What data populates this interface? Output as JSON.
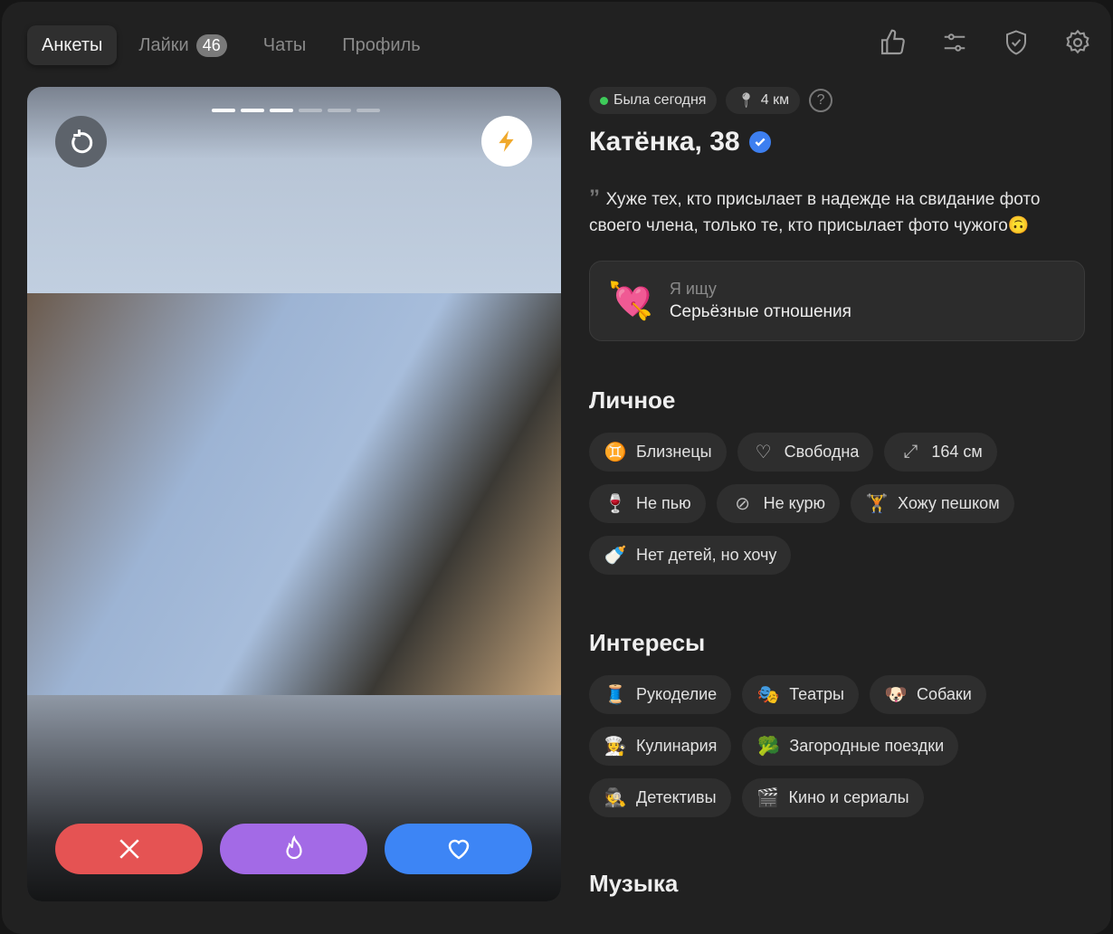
{
  "nav": {
    "tabs": [
      {
        "label": "Анкеты"
      },
      {
        "label": "Лайки",
        "badge": "46"
      },
      {
        "label": "Чаты"
      },
      {
        "label": "Профиль"
      }
    ]
  },
  "tools": [
    "thumbs-up-icon",
    "sliders-icon",
    "shield-icon",
    "gear-icon"
  ],
  "card": {
    "photo_index": 3,
    "photo_count": 6
  },
  "profile": {
    "status": "Была сегодня",
    "distance": "4 км",
    "name": "Катёнка, 38",
    "quote": "Хуже тех, кто присылает в надежде на свидание фото своего члена, только те, кто присылает фото чужого",
    "quote_emoji": "🙃",
    "seeking_label": "Я ищу",
    "seeking_value": "Серьёзные отношения",
    "seeking_emoji": "💘"
  },
  "personal": {
    "title": "Личное",
    "items": [
      {
        "icon": "♊",
        "label": "Близнецы"
      },
      {
        "icon": "♡",
        "label": "Свободна"
      },
      {
        "icon": "⤢",
        "label": "164 см"
      },
      {
        "icon": "🍷",
        "label": "Не пью"
      },
      {
        "icon": "⊘",
        "label": "Не курю"
      },
      {
        "icon": "🏋",
        "label": "Хожу пешком"
      },
      {
        "icon": "🍼",
        "label": "Нет детей, но хочу"
      }
    ]
  },
  "interests": {
    "title": "Интересы",
    "items": [
      {
        "icon": "🧵",
        "label": "Рукоделие"
      },
      {
        "icon": "🎭",
        "label": "Театры"
      },
      {
        "icon": "🐶",
        "label": "Собаки"
      },
      {
        "icon": "👩‍🍳",
        "label": "Кулинария"
      },
      {
        "icon": "🥦",
        "label": "Загородные поездки"
      },
      {
        "icon": "🕵️",
        "label": "Детективы"
      },
      {
        "icon": "🎬",
        "label": "Кино и сериалы"
      }
    ]
  },
  "music": {
    "title": "Музыка"
  }
}
